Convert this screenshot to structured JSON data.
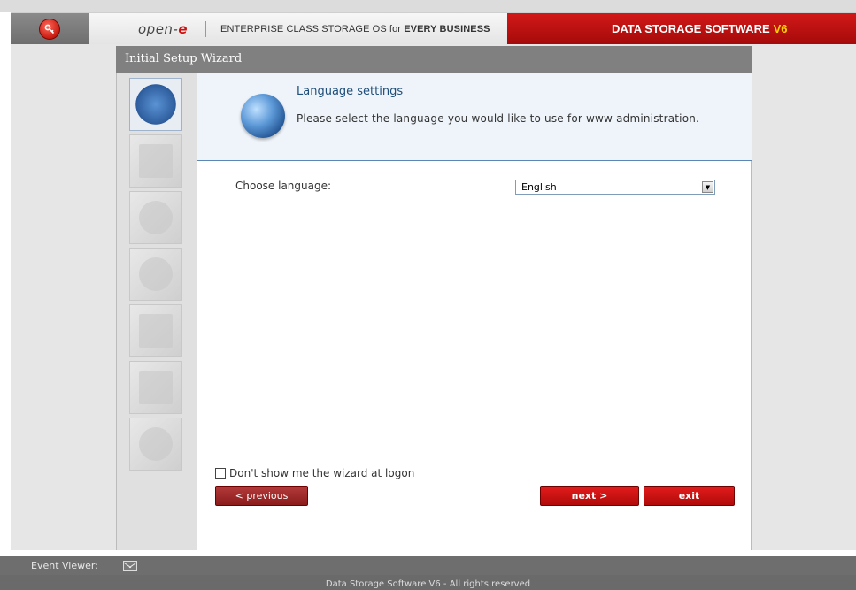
{
  "header": {
    "logo_text": "open-",
    "logo_e": "e",
    "tagline_prefix": "ENTERPRISE CLASS STORAGE OS for ",
    "tagline_bold": "EVERY BUSINESS",
    "product_name": "DATA STORAGE SOFTWARE",
    "product_version": "V6"
  },
  "wizard": {
    "title": "Initial Setup Wizard",
    "steps": [
      {
        "icon": "globe-icon",
        "active": true
      },
      {
        "icon": "monitor-lock-icon",
        "active": false
      },
      {
        "icon": "network-icon",
        "active": false
      },
      {
        "icon": "clock-icon",
        "active": false
      },
      {
        "icon": "grid-icon",
        "active": false
      },
      {
        "icon": "chart-icon",
        "active": false
      },
      {
        "icon": "info-icon",
        "active": false
      }
    ],
    "info": {
      "title": "Language settings",
      "description": "Please select the language you would like to use for www administration."
    },
    "form": {
      "language_label": "Choose language:",
      "language_value": "English"
    },
    "checkbox_label": "Don't show me the wizard at logon",
    "buttons": {
      "previous": "< previous",
      "next": "next >",
      "exit": "exit"
    }
  },
  "footer": {
    "event_viewer_label": "Event Viewer:",
    "copyright": "Data Storage Software V6 - All rights reserved"
  },
  "colors": {
    "brand_red": "#c41010",
    "version_yellow": "#ffd200",
    "titlebar_gray": "#808080"
  }
}
